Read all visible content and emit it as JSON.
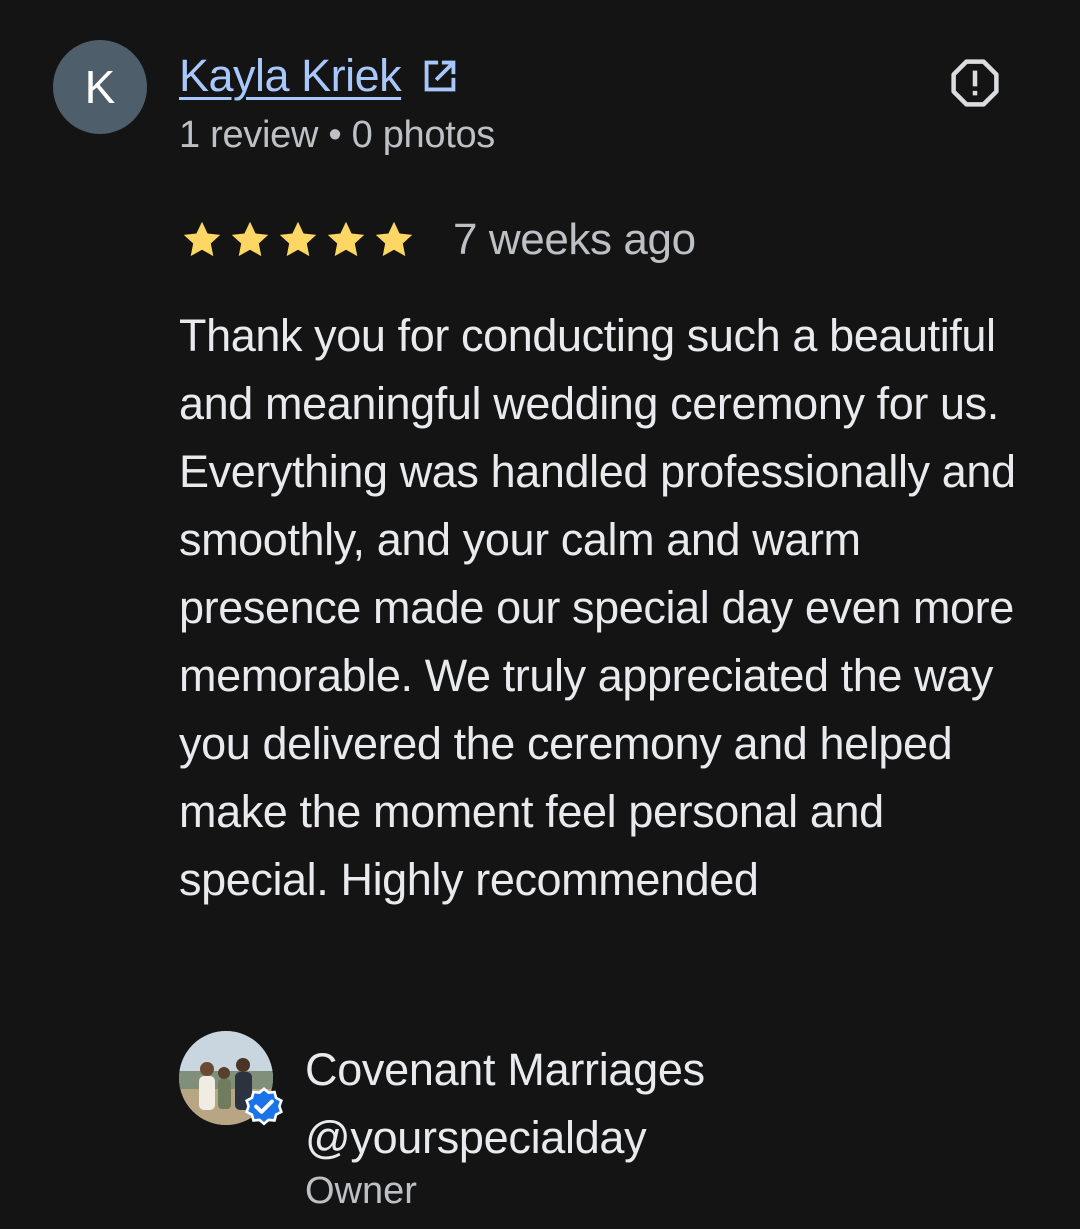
{
  "review": {
    "avatar_letter": "K",
    "reviewer_name": "Kayla Kriek",
    "reviewer_meta": "1 review • 0 photos",
    "rating": 5,
    "date": "7 weeks ago",
    "text": "Thank you for conducting such a beautiful and meaningful wedding ceremony for us. Everything was handled professionally and smoothly, and your calm and warm presence made our special day even more memorable. We truly appreciated the way you delivered the ceremony and helped make the moment feel personal and special. Highly recommended"
  },
  "owner_reply": {
    "name": "Covenant Marriages @yourspecialday",
    "role": "Owner",
    "verified": true
  },
  "icons": {
    "external_link": "external-link-icon",
    "report": "report-icon",
    "star": "star-icon",
    "verified": "verified-badge-icon"
  },
  "colors": {
    "background": "#141414",
    "link": "#a8c7fa",
    "star": "#fdd663",
    "text_primary": "#e8eaed",
    "text_secondary": "#bdc1c6",
    "verified": "#1a73e8",
    "avatar_bg": "#4e5f6b"
  }
}
